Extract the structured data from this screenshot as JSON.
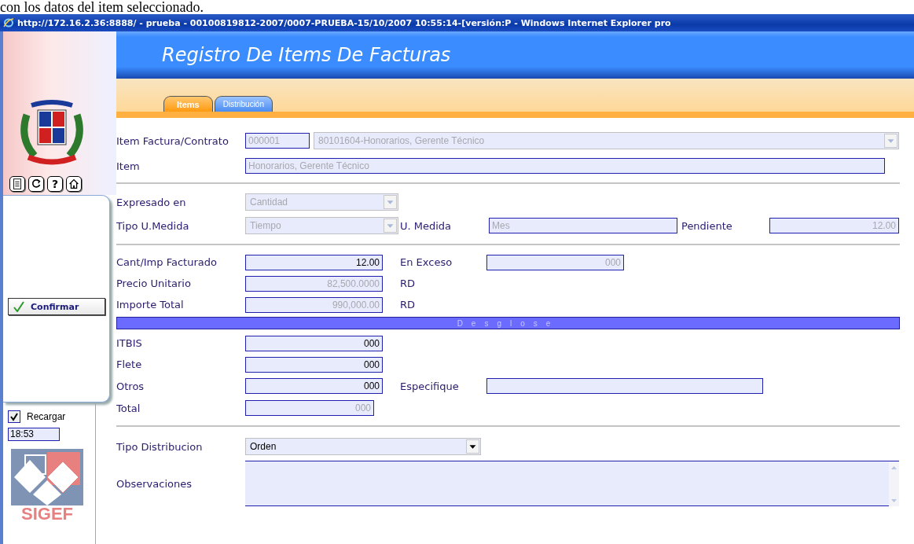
{
  "caption": "con los datos del item seleccionado.",
  "window": {
    "title": "http://172.16.2.36:8888/ - prueba - 00100819812-2007/0007-PRUEBA-15/10/2007 10:55:14-[versión:P - Windows Internet Explorer pro"
  },
  "header": {
    "title": "Registro De Items De Facturas"
  },
  "tabs": [
    {
      "label": "Items",
      "selected": true
    },
    {
      "label": "Distribución",
      "selected": false
    }
  ],
  "sidebar": {
    "toolbar": [
      {
        "kind": "document"
      },
      {
        "kind": "refresh"
      },
      {
        "kind": "help",
        "glyph": "?"
      },
      {
        "kind": "home"
      }
    ],
    "confirm_button": "Confirmar",
    "reload": {
      "label": "Recargar",
      "checked": true
    },
    "time": "18:53",
    "logo_text": "SIGEF"
  },
  "form": {
    "sections": [
      {
        "rows": [
          {
            "label": "Item Factura/Contrato",
            "items": [
              {
                "kind": "input",
                "value": "000001",
                "disabled": true
              },
              {
                "kind": "select",
                "value": "80101604-Honorarios, Gerente Técnico",
                "disabled": true
              }
            ]
          },
          {
            "label": "Item",
            "items": [
              {
                "kind": "input",
                "value": "Honorarios, Gerente Técnico",
                "disabled": true
              }
            ]
          }
        ]
      },
      {
        "rows": [
          {
            "label": "Expresado en",
            "items": [
              {
                "kind": "select",
                "value": "Cantidad",
                "disabled": true
              }
            ]
          },
          {
            "label": "Tipo U.Medida",
            "items": [
              {
                "kind": "select",
                "value": "Tiempo",
                "disabled": true
              },
              {
                "kind": "label",
                "text": "U. Medida"
              },
              {
                "kind": "input",
                "value": "Mes",
                "disabled": true
              },
              {
                "kind": "label",
                "text": "Pendiente"
              },
              {
                "kind": "input",
                "value": "12.00",
                "disabled": true
              }
            ]
          }
        ]
      },
      {
        "rows": [
          {
            "label": "Cant/Imp Facturado",
            "items": [
              {
                "kind": "input",
                "value": "12.00",
                "disabled": false
              },
              {
                "kind": "label",
                "text": "En Exceso"
              },
              {
                "kind": "input",
                "value": "000",
                "disabled": true
              }
            ]
          },
          {
            "label": "Precio Unitario",
            "items": [
              {
                "kind": "input",
                "value": "82,500.0000",
                "disabled": true
              },
              {
                "kind": "label",
                "text": "RD"
              }
            ]
          },
          {
            "label": "Importe Total",
            "items": [
              {
                "kind": "input",
                "value": "990,000.00",
                "disabled": true
              },
              {
                "kind": "label",
                "text": "RD"
              }
            ]
          },
          {
            "kind": "band",
            "text": "Desglose"
          },
          {
            "label": "ITBIS",
            "items": [
              {
                "kind": "input",
                "value": "000",
                "disabled": false
              }
            ]
          },
          {
            "label": "Flete",
            "items": [
              {
                "kind": "input",
                "value": "000",
                "disabled": false
              }
            ]
          },
          {
            "label": "Otros",
            "items": [
              {
                "kind": "input",
                "value": "000",
                "disabled": false
              },
              {
                "kind": "label",
                "text": "Especifique"
              },
              {
                "kind": "input",
                "value": ""
              }
            ]
          },
          {
            "label": "Total",
            "items": [
              {
                "kind": "input",
                "value": "000",
                "disabled": true
              }
            ]
          }
        ]
      },
      {
        "rows": [
          {
            "label": "Tipo Distribucion",
            "items": [
              {
                "kind": "select",
                "value": "Orden",
                "disabled": false
              }
            ]
          },
          {
            "label": "Observaciones",
            "items": [
              {
                "kind": "textarea",
                "value": ""
              }
            ]
          }
        ]
      }
    ]
  }
}
